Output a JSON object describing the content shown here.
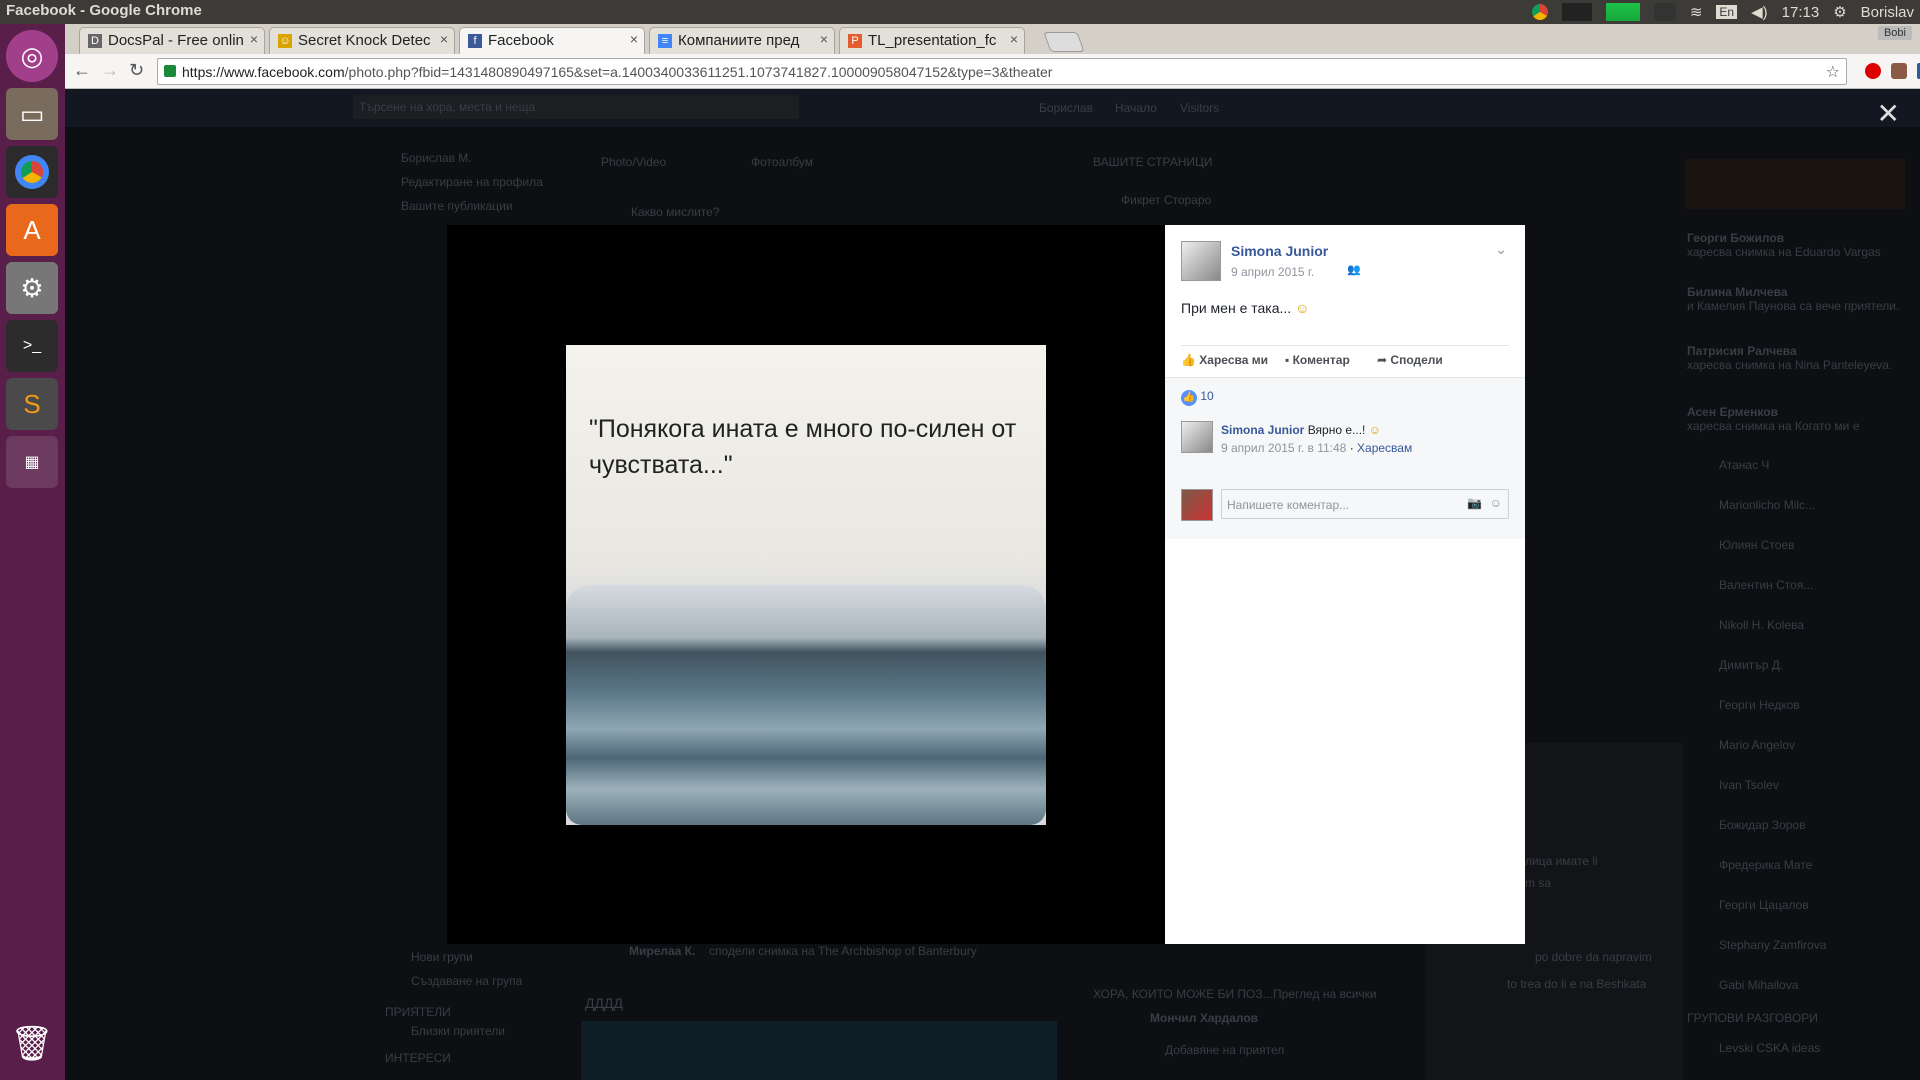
{
  "window": {
    "title": "Facebook - Google Chrome",
    "lang": "En",
    "time": "17:13",
    "user": "Borislav",
    "profile": "Bobi"
  },
  "tabs": [
    {
      "label": "DocsPal - Free onlin",
      "color": "#666"
    },
    {
      "label": "Secret Knock Detec",
      "color": "#d9a300"
    },
    {
      "label": "Facebook",
      "color": "#3b5998"
    },
    {
      "label": "Компаниите пред",
      "color": "#4285f4"
    },
    {
      "label": "TL_presentation_fc",
      "color": "#e35d2f"
    }
  ],
  "address": {
    "domain": "https://www.facebook.com",
    "path": "/photo.php?fbid=1431480890497165&set=a.1400340033611251.1073741827.100009058047152&type=3&theater"
  },
  "background": {
    "search_placeholder": "Търсене на хора, места и неща",
    "nav": [
      "Борислав",
      "Начало",
      "Visitors"
    ],
    "left": [
      "Борислав М.",
      "Редактиране на профила",
      "Вашите публикации",
      "Нови групи",
      "Създаване на група",
      "ПРИЯТЕЛИ",
      "Близки приятели",
      "ИНТЕРЕСИ"
    ],
    "composer_tabs": [
      "Photo/Video",
      "Фотоалбум"
    ],
    "composer_placeholder": "Какво мислите?",
    "pages_header": "ВАШИТЕ СТРАНИЦИ",
    "page_name": "Фикрет Стораро",
    "post_author": "Мирелаа К.",
    "post_text": "ДДДД",
    "post_line": "сподели снимка на The Archbishop of Banterbury",
    "suggest_header": "ХОРА, КОИТО МОЖЕ БИ ПОЗ...",
    "suggest_name": "Мончил Хардалов",
    "suggest_btn": "Добавяне на приятел",
    "see_all": "Преглед на всички",
    "ticker": [
      {
        "name": "Георги Божилов",
        "text": "харесва снимка на Eduardo Vargas"
      },
      {
        "name": "Билина Милчева",
        "text": "и Камелия Паунова са вече приятели."
      },
      {
        "name": "Патрисия Ралчева",
        "text": "харесва снимка на Nina Panteleyeva."
      },
      {
        "name": "Асен Ерменков",
        "text": "харесва снимка на Когато ми е"
      }
    ],
    "chat": [
      "Атанас Ч",
      "Marionlicho Milc...",
      "Юлиян Стоев",
      "Валентин Стоя...",
      "Nikoll H. Kolева",
      "Димитър Д.",
      "Георги Недков",
      "Mario Angelov",
      "Ivan Tsolev",
      "Божидар Зоров",
      "Фредерика Мате",
      "Георги Цацалов",
      "Stephany Zamfirova",
      "Gabi Mihailova"
    ],
    "group_chats": "ГРУПОВИ РАЗГОВОРИ",
    "group_chat_name": "Levski CSKA ideas",
    "chatwin_lines": [
      "лица имате li",
      "m sa",
      "po dobre da napravim",
      "to trea do li e na Beshkata"
    ]
  },
  "photo": {
    "quote": "\"Понякога ината е много по-силен от чувствата...\""
  },
  "post": {
    "author": "Simona Junior",
    "date": "9 април 2015 г.",
    "text": "При мен е така...",
    "actions": {
      "like": "Харесва ми",
      "comment": "Коментар",
      "share": "Сподели"
    },
    "likes": "10",
    "comment": {
      "author": "Simona Junior",
      "text": "Вярно е...!",
      "meta": "9 април 2015 г. в 11:48",
      "like_link": "Харесвам"
    },
    "comment_placeholder": "Напишете коментар..."
  }
}
